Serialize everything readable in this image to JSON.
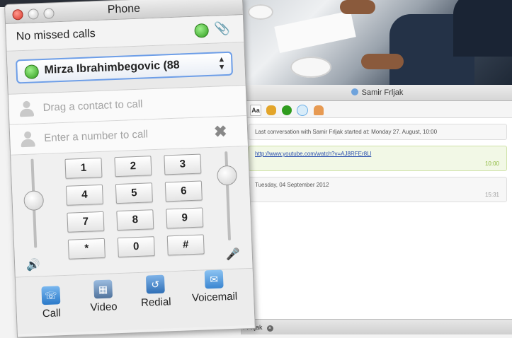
{
  "chat": {
    "title": "Samir Frljak",
    "toolbar_icons": [
      "font-icon",
      "emoticon-icon",
      "call-icon",
      "chat-icon",
      "contact-icon"
    ],
    "toolbar_font_label": "Aa",
    "messages": [
      {
        "text": "Last conversation with Samir Frljak started at: Monday 27. August, 10:00",
        "time": ""
      },
      {
        "text": "http://www.youtube.com/watch?v=AJ8RFEr8Ll",
        "time": "10:00"
      },
      {
        "text": "Tuesday, 04 September 2012",
        "time": "15:31"
      }
    ],
    "tab_label": "r Frljak"
  },
  "phone": {
    "title": "Phone",
    "status_text": "No missed calls",
    "contact_selected": "Mirza Ibrahimbegovic (88",
    "drag_placeholder": "Drag a contact to call",
    "number_placeholder": "Enter a number to call",
    "volume_level": 0.55,
    "mic_level": 0.8,
    "keypad": [
      "1",
      "2",
      "3",
      "4",
      "5",
      "6",
      "7",
      "8",
      "9",
      "*",
      "0",
      "#"
    ],
    "actions": [
      {
        "label": "Call",
        "icon": "phone-icon"
      },
      {
        "label": "Video",
        "icon": "film-icon"
      },
      {
        "label": "Redial",
        "icon": "redial-icon"
      },
      {
        "label": "Voicemail",
        "icon": "mail-icon"
      }
    ],
    "colors": {
      "online": "#2f9c1e",
      "accent": "#2a79c9"
    }
  }
}
